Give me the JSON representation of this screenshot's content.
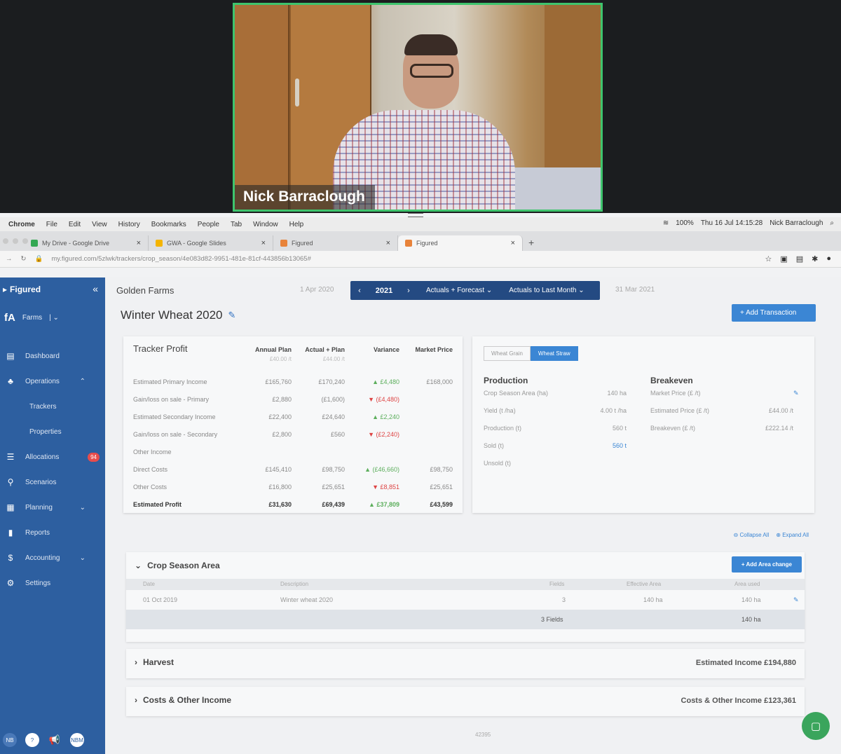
{
  "video": {
    "participant_name": "Nick Barraclough"
  },
  "mac_menu": {
    "items": [
      "Chrome",
      "File",
      "Edit",
      "View",
      "History",
      "Bookmarks",
      "People",
      "Tab",
      "Window",
      "Help"
    ],
    "battery": "100%",
    "clock": "Thu 16 Jul  14:15:28",
    "user": "Nick Barraclough"
  },
  "browser": {
    "tabs": [
      {
        "label": "My Drive - Google Drive",
        "color": "#34a853"
      },
      {
        "label": "GWA - Google Slides",
        "color": "#f4b400"
      },
      {
        "label": "Figured",
        "color": "#e8833a"
      },
      {
        "label": "Figured",
        "color": "#e8833a"
      }
    ],
    "url": "my.figured.com/5zlwk/trackers/crop_season/4e083d82-9951-481e-81cf-443856b13065#"
  },
  "sidebar": {
    "brand": "Figured",
    "farm_label": "Farms",
    "items": [
      {
        "label": "Dashboard",
        "icon": "dashboard-icon",
        "glyph": "▤"
      },
      {
        "label": "Operations",
        "icon": "operations-icon",
        "glyph": "♣"
      },
      {
        "label": "Trackers",
        "sub": true
      },
      {
        "label": "Properties",
        "sub": true
      },
      {
        "label": "Allocations",
        "icon": "allocations-icon",
        "glyph": "☰",
        "badge": "94"
      },
      {
        "label": "Scenarios",
        "icon": "scenarios-icon",
        "glyph": "⚲"
      },
      {
        "label": "Planning",
        "icon": "planning-icon",
        "glyph": "▦"
      },
      {
        "label": "Reports",
        "icon": "reports-icon",
        "glyph": "▮"
      },
      {
        "label": "Accounting",
        "icon": "accounting-icon",
        "glyph": "$"
      },
      {
        "label": "Settings",
        "icon": "settings-icon",
        "glyph": "⚙"
      }
    ],
    "bottom": [
      "NB",
      "?",
      "",
      "NBM"
    ]
  },
  "topbar": {
    "farm_name": "Golden Farms",
    "date_start": "1 Apr 2020",
    "year": "2021",
    "mode": "Actuals + Forecast",
    "actuals_range": "Actuals to Last Month",
    "date_end": "31 Mar 2021"
  },
  "page": {
    "title": "Winter Wheat 2020",
    "add_transaction": "+  Add Transaction"
  },
  "tracker": {
    "title": "Tracker Profit",
    "columns": [
      "Annual Plan",
      "Actual + Plan",
      "Variance",
      "Market Price"
    ],
    "subheaders": [
      "£40.00 /t",
      "£44.00 /t"
    ],
    "rows": [
      {
        "label": "Estimated Primary Income",
        "annual": "£165,760",
        "actual": "£170,240",
        "variance": "▲ £4,480",
        "vclass": "pos",
        "market": "£168,000"
      },
      {
        "label": "Gain/loss on sale - Primary",
        "annual": "£2,880",
        "actual": "(£1,600)",
        "variance": "▼ (£4,480)",
        "vclass": "neg",
        "market": ""
      },
      {
        "label": "Estimated Secondary Income",
        "annual": "£22,400",
        "actual": "£24,640",
        "variance": "▲ £2,240",
        "vclass": "pos",
        "market": ""
      },
      {
        "label": "Gain/loss on sale - Secondary",
        "annual": "£2,800",
        "actual": "£560",
        "variance": "▼ (£2,240)",
        "vclass": "neg",
        "market": ""
      },
      {
        "label": "Other Income",
        "annual": "",
        "actual": "",
        "variance": "",
        "vclass": "",
        "market": ""
      },
      {
        "label": "Direct Costs",
        "annual": "£145,410",
        "actual": "£98,750",
        "variance": "▲ (£46,660)",
        "vclass": "pos",
        "market": "£98,750"
      },
      {
        "label": "Other Costs",
        "annual": "£16,800",
        "actual": "£25,651",
        "variance": "▼ £8,851",
        "vclass": "neg",
        "market": "£25,651"
      },
      {
        "label": "Estimated Profit",
        "annual": "£31,630",
        "actual": "£69,439",
        "variance": "▲ £37,809",
        "vclass": "pos",
        "market": "£43,599",
        "bold": true
      }
    ]
  },
  "production_panel": {
    "toggle": [
      "Wheat Grain",
      "Wheat Straw"
    ],
    "production_title": "Production",
    "production_rows": [
      {
        "label": "Crop Season Area (ha)",
        "value": "140 ha"
      },
      {
        "label": "Yield (t /ha)",
        "value": "4.00 t /ha"
      },
      {
        "label": "Production (t)",
        "value": "560 t"
      },
      {
        "label": "Sold (t)",
        "value": "560 t",
        "link": true
      },
      {
        "label": "Unsold (t)",
        "value": ""
      }
    ],
    "breakeven_title": "Breakeven",
    "breakeven_rows": [
      {
        "label": "Market Price (£ /t)",
        "value": ""
      },
      {
        "label": "Estimated Price (£ /t)",
        "value": "£44.00 /t"
      },
      {
        "label": "Breakeven (£ /t)",
        "value": "£222.14 /t"
      }
    ]
  },
  "expand_links": {
    "collapse": "Collapse All",
    "expand": "Expand All"
  },
  "crop_season": {
    "title": "Crop Season Area",
    "add_button": "+  Add Area change",
    "headers": [
      "Date",
      "Description",
      "Fields",
      "Effective Area",
      "Area used"
    ],
    "row": {
      "date": "01 Oct 2019",
      "description": "Winter wheat 2020",
      "fields": "3",
      "effective": "140 ha",
      "used": "140 ha"
    },
    "total": {
      "fields": "3 Fields",
      "used": "140 ha"
    }
  },
  "harvest": {
    "title": "Harvest",
    "summary": "Estimated Income £194,880"
  },
  "costs": {
    "title": "Costs & Other Income",
    "summary": "Costs & Other Income £123,361"
  },
  "footer": {
    "number": "42395"
  }
}
